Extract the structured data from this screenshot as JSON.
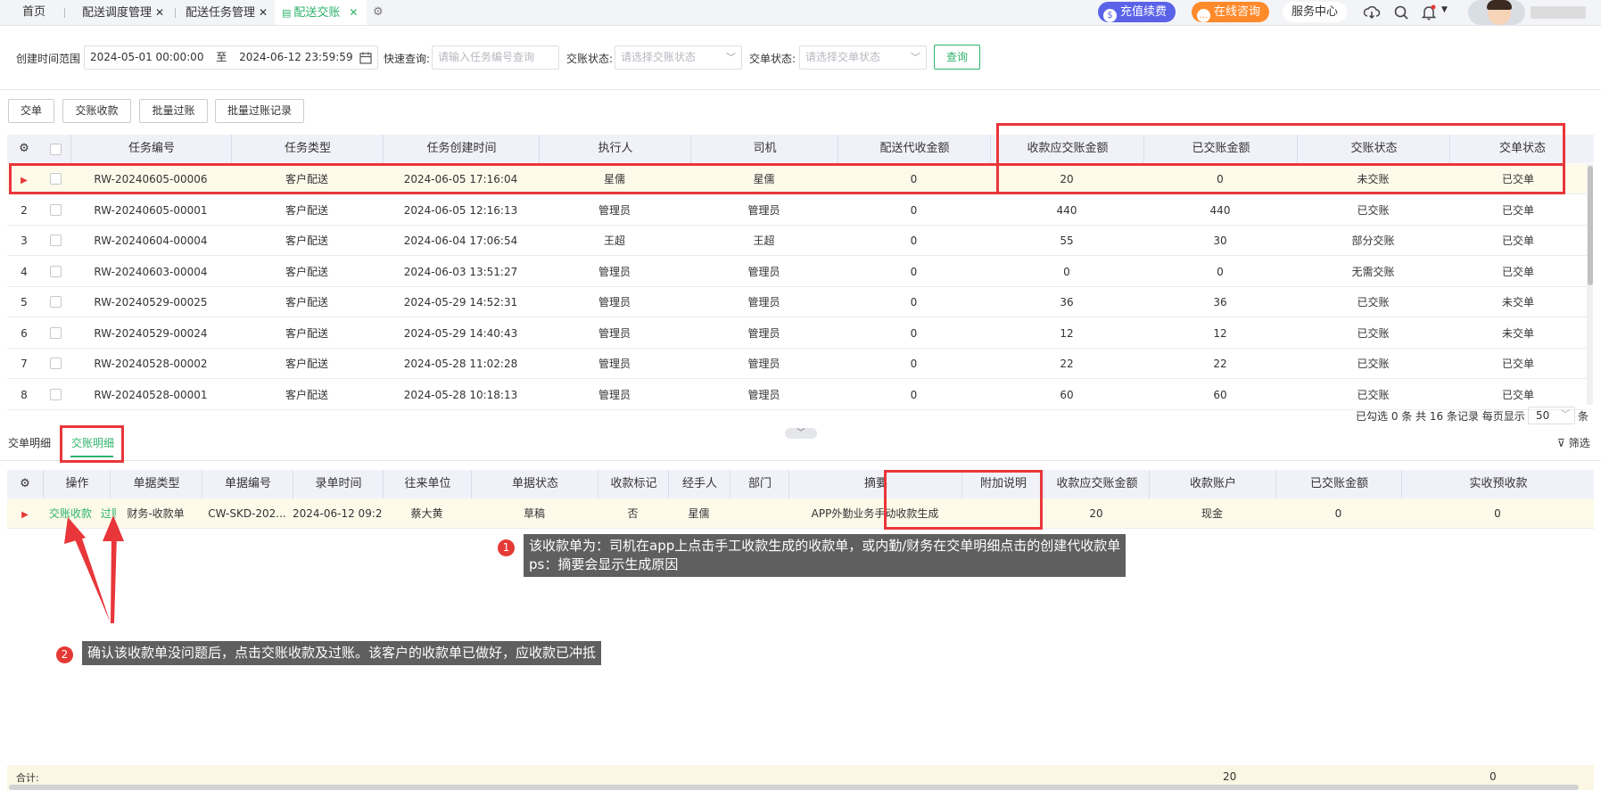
{
  "tabs": [
    {
      "label": "首页",
      "closable": false
    },
    {
      "label": "配送调度管理",
      "closable": true
    },
    {
      "label": "配送任务管理",
      "closable": true
    },
    {
      "label": "配送交账",
      "closable": true,
      "active": true
    }
  ],
  "header": {
    "recharge": "充值续费",
    "consult": "在线咨询",
    "service": "服务中心"
  },
  "filters": {
    "time_label": "创建时间范围",
    "time_start": "2024-05-01 00:00:00",
    "time_to": "至",
    "time_end": "2024-06-12 23:59:59",
    "quick_label": "快速查询:",
    "quick_placeholder": "请输入任务编号查询",
    "account_status_label": "交账状态:",
    "account_status_placeholder": "请选择交账状态",
    "order_status_label": "交单状态:",
    "order_status_placeholder": "请选择交单状态",
    "query": "查询"
  },
  "toolbar": {
    "submit": "交单",
    "account_receive": "交账收款",
    "batch_post": "批量过账",
    "batch_post_records": "批量过账记录"
  },
  "main_table": {
    "columns": [
      "任务编号",
      "任务类型",
      "任务创建时间",
      "执行人",
      "司机",
      "配送代收金额",
      "收款应交账金额",
      "已交账金额",
      "交账状态",
      "交单状态"
    ],
    "rows": [
      {
        "idx": "",
        "no": "RW-20240605-00006",
        "type": "客户配送",
        "time": "2024-06-05 17:16:04",
        "exec": "星儒",
        "driver": "星儒",
        "cod": "0",
        "due": "20",
        "paid": "0",
        "acc": "未交账",
        "ord": "已交单"
      },
      {
        "idx": "2",
        "no": "RW-20240605-00001",
        "type": "客户配送",
        "time": "2024-06-05 12:16:13",
        "exec": "管理员",
        "driver": "管理员",
        "cod": "0",
        "due": "440",
        "paid": "440",
        "acc": "已交账",
        "ord": "已交单"
      },
      {
        "idx": "3",
        "no": "RW-20240604-00004",
        "type": "客户配送",
        "time": "2024-06-04 17:06:54",
        "exec": "王超",
        "driver": "王超",
        "cod": "0",
        "due": "55",
        "paid": "30",
        "acc": "部分交账",
        "ord": "已交单"
      },
      {
        "idx": "4",
        "no": "RW-20240603-00004",
        "type": "客户配送",
        "time": "2024-06-03 13:51:27",
        "exec": "管理员",
        "driver": "管理员",
        "cod": "0",
        "due": "0",
        "paid": "0",
        "acc": "无需交账",
        "ord": "已交单"
      },
      {
        "idx": "5",
        "no": "RW-20240529-00025",
        "type": "客户配送",
        "time": "2024-05-29 14:52:31",
        "exec": "管理员",
        "driver": "管理员",
        "cod": "0",
        "due": "36",
        "paid": "36",
        "acc": "已交账",
        "ord": "未交单"
      },
      {
        "idx": "6",
        "no": "RW-20240529-00024",
        "type": "客户配送",
        "time": "2024-05-29 14:40:43",
        "exec": "管理员",
        "driver": "管理员",
        "cod": "0",
        "due": "12",
        "paid": "12",
        "acc": "已交账",
        "ord": "未交单"
      },
      {
        "idx": "7",
        "no": "RW-20240528-00002",
        "type": "客户配送",
        "time": "2024-05-28 11:02:28",
        "exec": "管理员",
        "driver": "管理员",
        "cod": "0",
        "due": "22",
        "paid": "22",
        "acc": "已交账",
        "ord": "已交单"
      },
      {
        "idx": "8",
        "no": "RW-20240528-00001",
        "type": "客户配送",
        "time": "2024-05-28 10:18:13",
        "exec": "管理员",
        "driver": "管理员",
        "cod": "0",
        "due": "60",
        "paid": "60",
        "acc": "已交账",
        "ord": "已交单"
      }
    ]
  },
  "pager": {
    "summary": "已勾选 0 条  共 16 条记录  每页显示",
    "page_size": "50",
    "unit": "条"
  },
  "detail_tabs": {
    "submit_detail": "交单明细",
    "account_detail": "交账明细",
    "filter": "筛选"
  },
  "detail_table": {
    "columns": [
      "操作",
      "单据类型",
      "单据编号",
      "录单时间",
      "往来单位",
      "单据状态",
      "收款标记",
      "经手人",
      "部门",
      "摘要",
      "附加说明",
      "收款应交账金额",
      "收款账户",
      "已交账金额",
      "实收预收款"
    ],
    "row": {
      "op1": "交账收款",
      "op2": "过账",
      "doc_type": "财务-收款单",
      "doc_no": "CW-SKD-202...",
      "time": "2024-06-12 09:2...",
      "partner": "蔡大黄",
      "status": "草稿",
      "mark": "否",
      "handler": "星儒",
      "dept": "",
      "summary": "APP外勤业务手动收款生成",
      "remark": "",
      "due": "20",
      "account": "现金",
      "paid": "0",
      "prepay": "0"
    }
  },
  "annotations": {
    "n1": "1",
    "note1_line1": "该收款单为：司机在app上点击手工收款生成的收款单，或内勤/财务在交单明细点击的创建代收款单",
    "note1_line2": "ps：摘要会显示生成原因",
    "n2": "2",
    "note2": "确认该收款单没问题后，点击交账收款及过账。该客户的收款单已做好，应收款已冲抵"
  },
  "totals": {
    "label": "合计:",
    "due": "20",
    "paid": "0"
  },
  "colors": {
    "accent": "#2fb36b",
    "annotation": "#e8363a",
    "recharge": "#5a63e8",
    "consult": "#ff8a2b"
  }
}
